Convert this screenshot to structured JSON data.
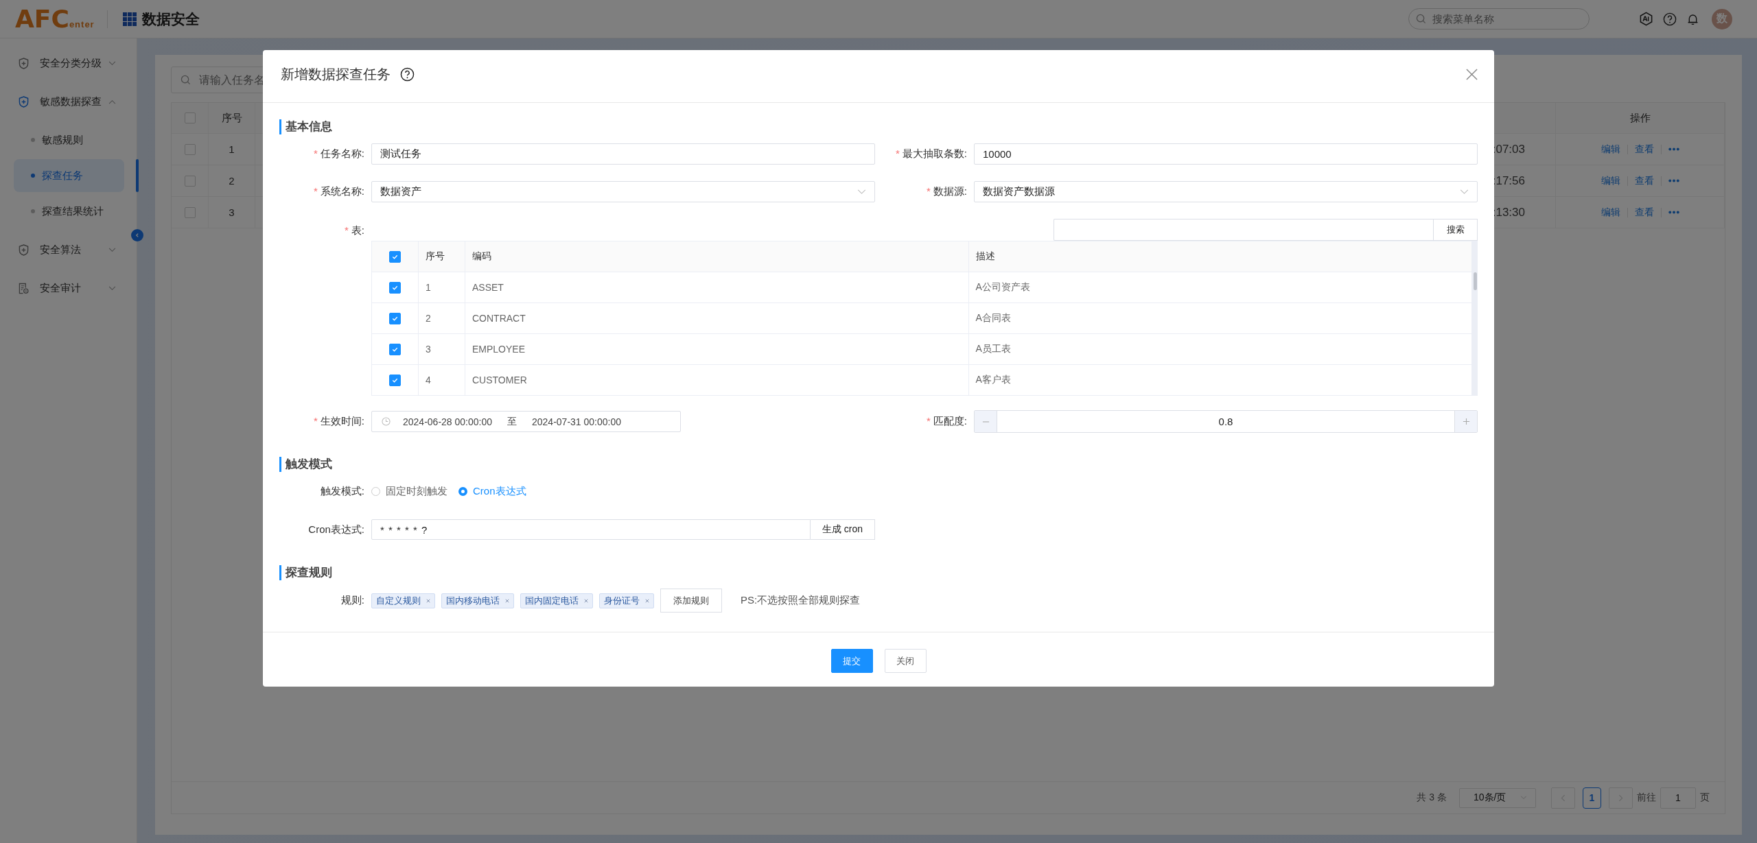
{
  "header": {
    "logo_main": "AFC",
    "logo_sub": "enter",
    "app_title": "数据安全",
    "search": {
      "placeholder": "搜索菜单名称"
    },
    "avatar": "数"
  },
  "sidebar": {
    "items": [
      {
        "label": "安全分类分级",
        "kind": "shield",
        "expanded": false
      },
      {
        "label": "敏感数据探查",
        "kind": "shield",
        "expanded": true,
        "children": [
          {
            "label": "敏感规则",
            "selected": false
          },
          {
            "label": "探查任务",
            "selected": true
          },
          {
            "label": "探查结果统计",
            "selected": false
          }
        ]
      },
      {
        "label": "安全算法",
        "kind": "shield",
        "expanded": false
      },
      {
        "label": "安全审计",
        "kind": "document",
        "expanded": false
      }
    ]
  },
  "page": {
    "search": {
      "placeholder": "请输入任务名"
    },
    "table": {
      "header_checked": false,
      "columns": [
        "序号",
        "操作"
      ],
      "rows": [
        {
          "checked": false,
          "index": "1",
          "time": ":07:03",
          "actions": [
            "编辑",
            "查看"
          ]
        },
        {
          "checked": false,
          "index": "2",
          "time": ":17:56",
          "actions": [
            "编辑",
            "查看"
          ]
        },
        {
          "checked": false,
          "index": "3",
          "time": ":13:30",
          "actions": [
            "编辑",
            "查看"
          ]
        }
      ]
    },
    "pagination": {
      "total": "共 3 条",
      "page_size": "10条/页",
      "pages": [
        {
          "label": "1",
          "selected": true
        }
      ],
      "goto_label": "前往",
      "goto_value": "1",
      "goto_suffix": "页"
    }
  },
  "dialog": {
    "title": "新增数据探查任务",
    "basic": {
      "heading": "基本信息",
      "task_name": {
        "marker": "*",
        "label": "任务名称:",
        "value": "测试任务"
      },
      "max_rows": {
        "marker": "*",
        "label": "最大抽取条数:",
        "value": "10000"
      },
      "system": {
        "marker": "*",
        "label": "系统名称:",
        "value": "数据资产"
      },
      "datasource": {
        "marker": "*",
        "label": "数据源:",
        "value": "数据资产数据源"
      },
      "tables": {
        "marker": "*",
        "label": "表:",
        "search_button": "搜索",
        "columns": [
          "序号",
          "编码",
          "描述"
        ],
        "all_checked": true,
        "rows": [
          {
            "checked": true,
            "index": "1",
            "code": "ASSET",
            "desc": "A公司资产表"
          },
          {
            "checked": true,
            "index": "2",
            "code": "CONTRACT",
            "desc": "A合同表"
          },
          {
            "checked": true,
            "index": "3",
            "code": "EMPLOYEE",
            "desc": "A员工表"
          },
          {
            "checked": true,
            "index": "4",
            "code": "CUSTOMER",
            "desc": "A客户表"
          }
        ]
      },
      "effective_time": {
        "marker": "*",
        "label": "生效时间:",
        "start": "2024-06-28 00:00:00",
        "separator": "至",
        "end": "2024-07-31 00:00:00"
      },
      "match": {
        "marker": "*",
        "label": "匹配度:",
        "value": "0.8"
      }
    },
    "trigger": {
      "heading": "触发模式",
      "mode": {
        "label": "触发模式:",
        "options": [
          {
            "label": "固定时刻触发",
            "selected": false
          },
          {
            "label": "Cron表达式",
            "selected": true
          }
        ]
      },
      "cron": {
        "label": "Cron表达式:",
        "value": "* * * * * ?",
        "button": "生成 cron"
      }
    },
    "rules": {
      "heading": "探查规则",
      "label": "规则:",
      "tags": [
        "自定义规则",
        "国内移动电话",
        "国内固定电话",
        "身份证号"
      ],
      "add_button": "添加规则",
      "note": "PS:不选按照全部规则探查"
    },
    "footer": {
      "buttons": [
        {
          "label": "提交",
          "kind": "primary"
        },
        {
          "label": "关闭",
          "kind": "default"
        }
      ]
    }
  }
}
